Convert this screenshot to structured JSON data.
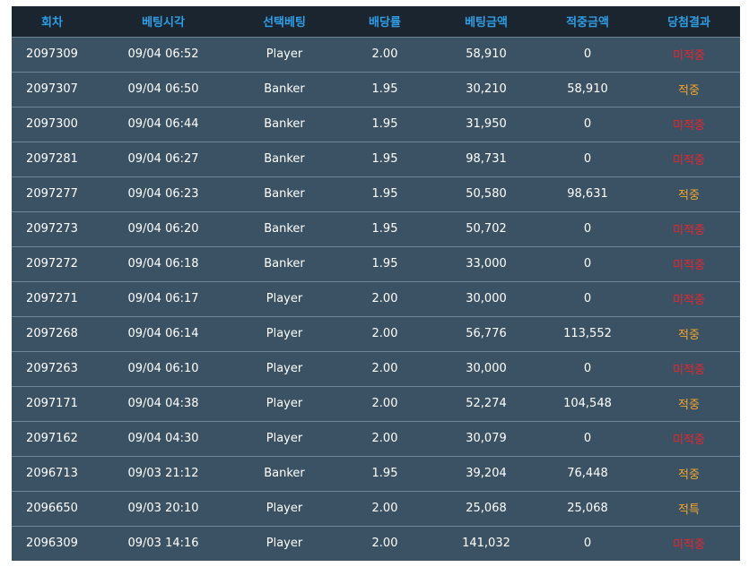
{
  "headers": [
    "회차",
    "베팅시각",
    "선택베팅",
    "배당률",
    "베팅금액",
    "적중금액",
    "당첨결과"
  ],
  "rows": [
    {
      "round": "2097309",
      "time": "09/04 06:52",
      "pick": "Player",
      "odds": "2.00",
      "bet": "58,910",
      "win": "0",
      "result": "미적중",
      "status": "miss"
    },
    {
      "round": "2097307",
      "time": "09/04 06:50",
      "pick": "Banker",
      "odds": "1.95",
      "bet": "30,210",
      "win": "58,910",
      "result": "적중",
      "status": "hit"
    },
    {
      "round": "2097300",
      "time": "09/04 06:44",
      "pick": "Banker",
      "odds": "1.95",
      "bet": "31,950",
      "win": "0",
      "result": "미적중",
      "status": "miss"
    },
    {
      "round": "2097281",
      "time": "09/04 06:27",
      "pick": "Banker",
      "odds": "1.95",
      "bet": "98,731",
      "win": "0",
      "result": "미적중",
      "status": "miss"
    },
    {
      "round": "2097277",
      "time": "09/04 06:23",
      "pick": "Banker",
      "odds": "1.95",
      "bet": "50,580",
      "win": "98,631",
      "result": "적중",
      "status": "hit"
    },
    {
      "round": "2097273",
      "time": "09/04 06:20",
      "pick": "Banker",
      "odds": "1.95",
      "bet": "50,702",
      "win": "0",
      "result": "미적중",
      "status": "miss"
    },
    {
      "round": "2097272",
      "time": "09/04 06:18",
      "pick": "Banker",
      "odds": "1.95",
      "bet": "33,000",
      "win": "0",
      "result": "미적중",
      "status": "miss"
    },
    {
      "round": "2097271",
      "time": "09/04 06:17",
      "pick": "Player",
      "odds": "2.00",
      "bet": "30,000",
      "win": "0",
      "result": "미적중",
      "status": "miss"
    },
    {
      "round": "2097268",
      "time": "09/04 06:14",
      "pick": "Player",
      "odds": "2.00",
      "bet": "56,776",
      "win": "113,552",
      "result": "적중",
      "status": "hit"
    },
    {
      "round": "2097263",
      "time": "09/04 06:10",
      "pick": "Player",
      "odds": "2.00",
      "bet": "30,000",
      "win": "0",
      "result": "미적중",
      "status": "miss"
    },
    {
      "round": "2097171",
      "time": "09/04 04:38",
      "pick": "Player",
      "odds": "2.00",
      "bet": "52,274",
      "win": "104,548",
      "result": "적중",
      "status": "hit"
    },
    {
      "round": "2097162",
      "time": "09/04 04:30",
      "pick": "Player",
      "odds": "2.00",
      "bet": "30,079",
      "win": "0",
      "result": "미적중",
      "status": "miss"
    },
    {
      "round": "2096713",
      "time": "09/03 21:12",
      "pick": "Banker",
      "odds": "1.95",
      "bet": "39,204",
      "win": "76,448",
      "result": "적중",
      "status": "hit"
    },
    {
      "round": "2096650",
      "time": "09/03 20:10",
      "pick": "Player",
      "odds": "2.00",
      "bet": "25,068",
      "win": "25,068",
      "result": "적특",
      "status": "hit"
    },
    {
      "round": "2096309",
      "time": "09/03 14:16",
      "pick": "Player",
      "odds": "2.00",
      "bet": "141,032",
      "win": "0",
      "result": "미적중",
      "status": "miss"
    }
  ],
  "colors": {
    "header_bg": "#1b2530",
    "header_text": "#2e9ee6",
    "row_bg": "#3a5264",
    "miss": "#e8262e",
    "hit": "#f4a52b"
  }
}
